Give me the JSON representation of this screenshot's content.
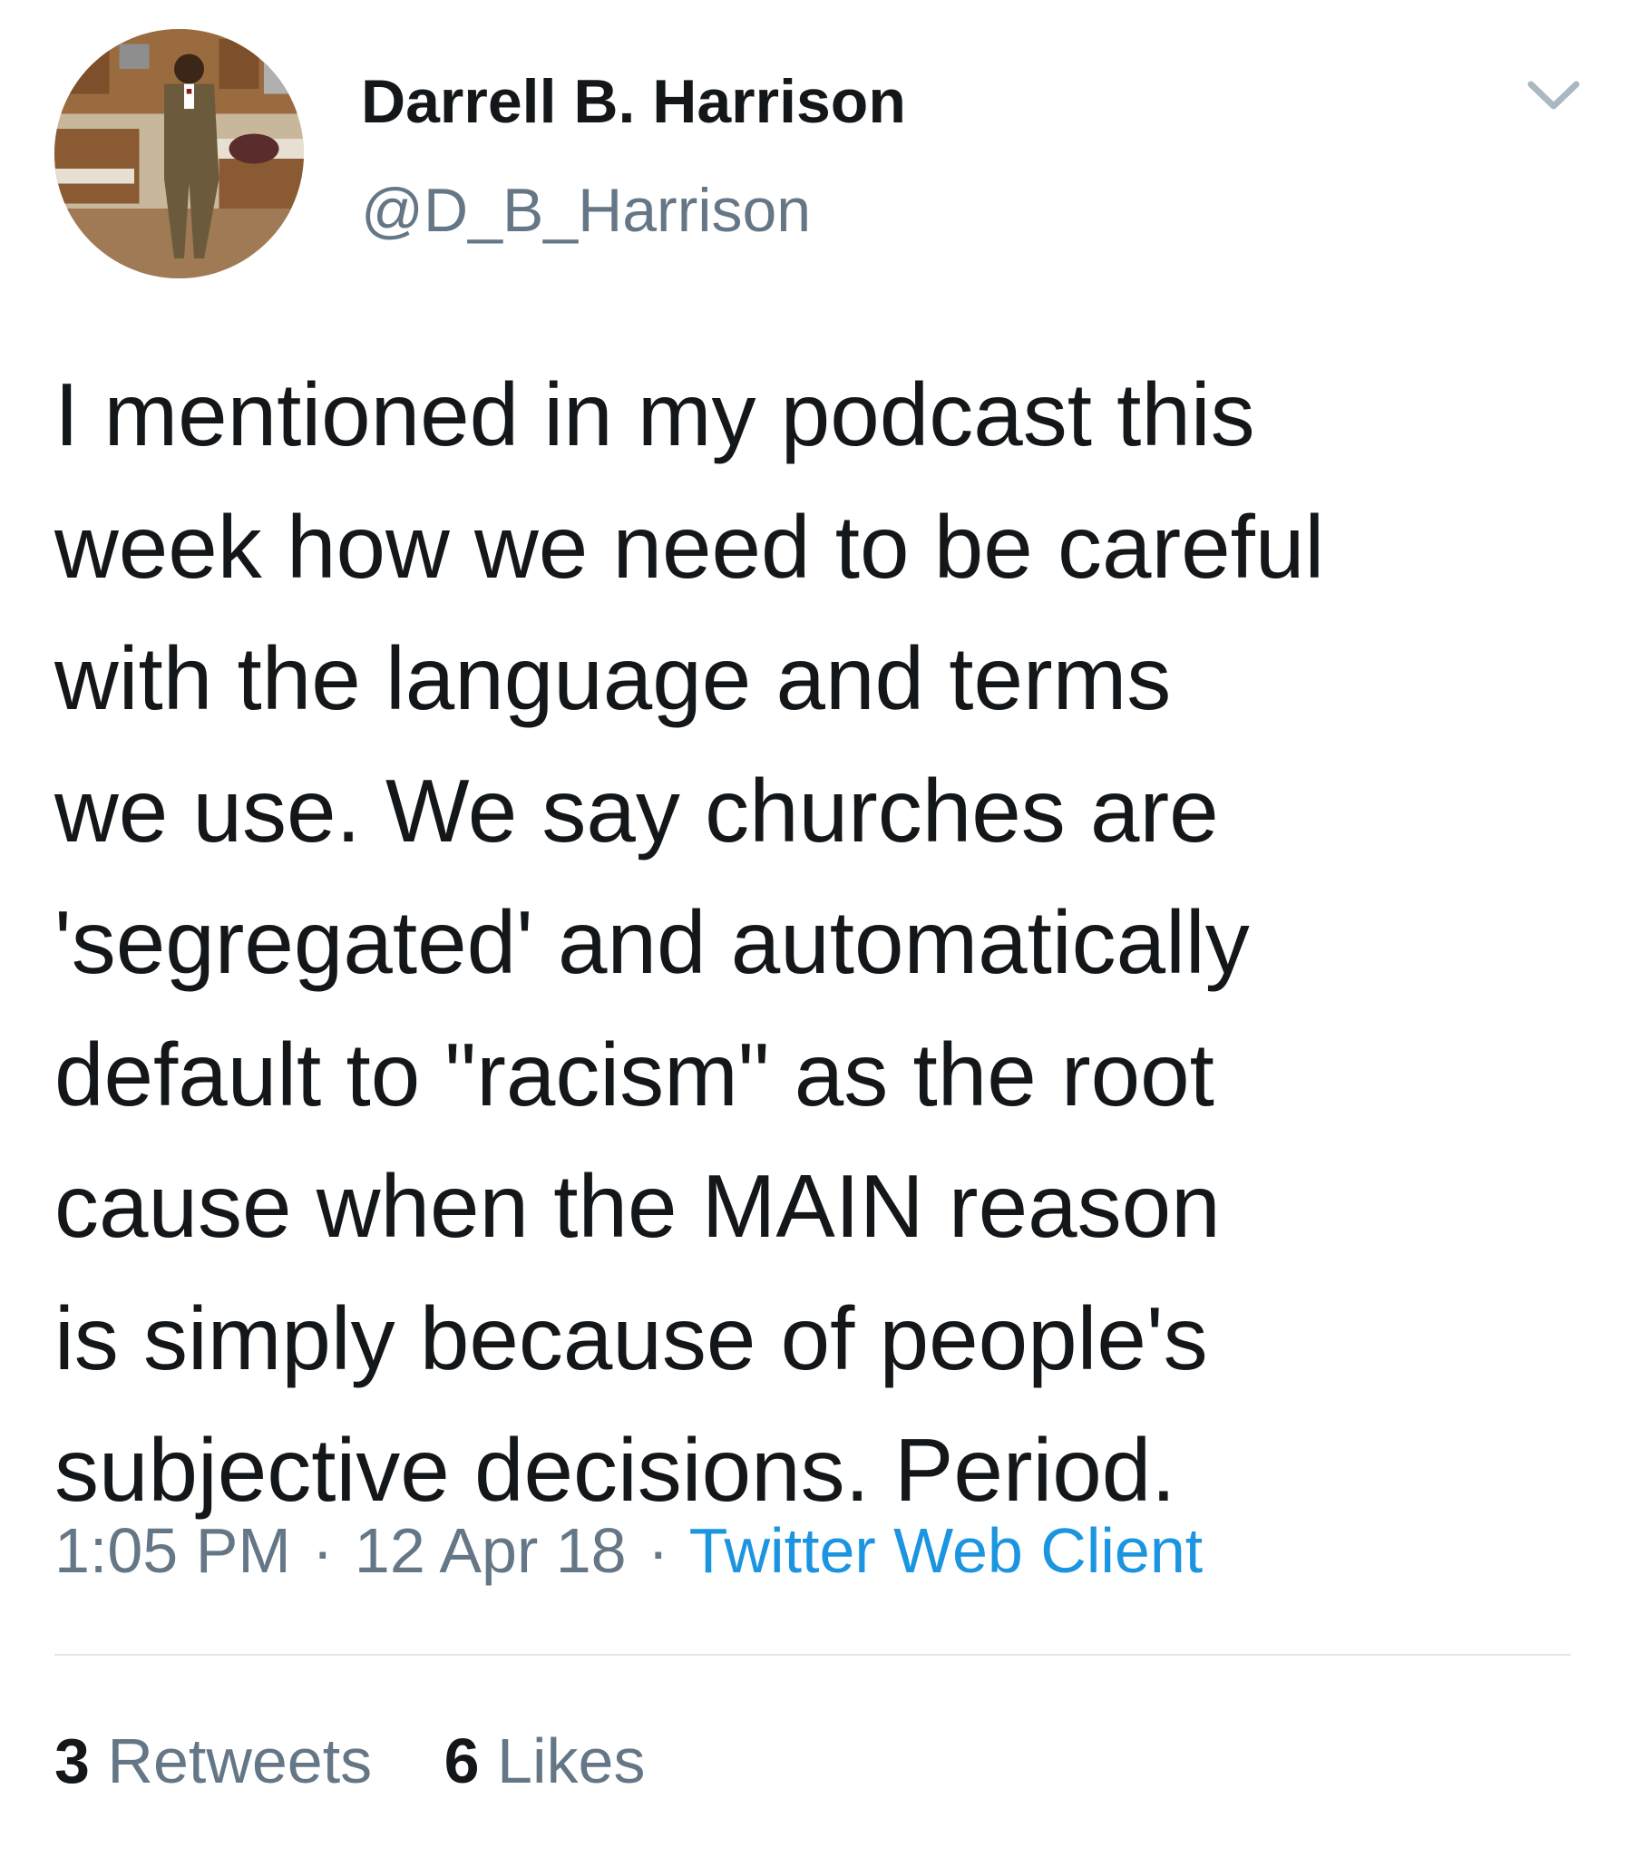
{
  "author": {
    "display_name": "Darrell B. Harrison",
    "handle": "@D_B_Harrison",
    "avatar_icon": "profile-photo"
  },
  "menu": {
    "icon": "chevron-down-icon"
  },
  "tweet": {
    "text_lines": [
      "I mentioned in my podcast this",
      "week how we need to be careful",
      "with the language and terms",
      "we use. We say churches are",
      "'segregated' and automatically",
      "default to \"racism\" as the root",
      "cause when the MAIN reason",
      "is simply because of people's",
      "subjective decisions. Period."
    ]
  },
  "meta": {
    "time": "1:05 PM",
    "separator": "·",
    "date": "12 Apr 18",
    "source": "Twitter Web Client"
  },
  "stats": {
    "retweets_count": "3",
    "retweets_label": "Retweets",
    "likes_count": "6",
    "likes_label": "Likes"
  },
  "colors": {
    "primary_text": "#14171a",
    "secondary_text": "#657786",
    "link": "#1b95e0",
    "divider": "#e1e8ed",
    "caret": "#aab8c2"
  }
}
